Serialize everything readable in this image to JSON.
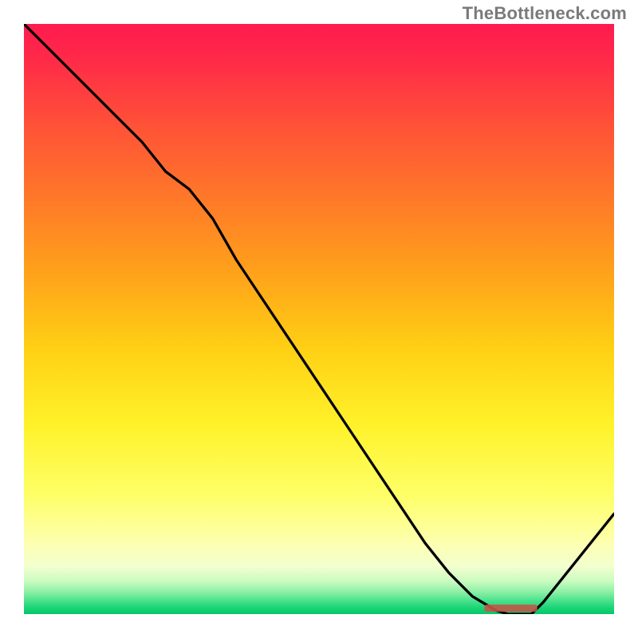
{
  "chart_data": {
    "type": "line",
    "title": "",
    "xlabel": "",
    "ylabel": "",
    "xlim": [
      0,
      100
    ],
    "ylim": [
      0,
      100
    ],
    "x": [
      0,
      4,
      8,
      12,
      16,
      20,
      24,
      28,
      32,
      36,
      40,
      44,
      48,
      52,
      56,
      60,
      64,
      68,
      72,
      76,
      80,
      82,
      84,
      86,
      88,
      92,
      96,
      100
    ],
    "values": [
      100,
      96,
      92,
      88,
      84,
      80,
      75,
      72,
      67,
      60,
      54,
      48,
      42,
      36,
      30,
      24,
      18,
      12,
      7,
      3,
      0.6,
      0,
      0,
      0,
      2,
      7,
      12,
      17
    ],
    "marker_segment": {
      "x_start": 78,
      "x_end": 87,
      "y": 1.0
    },
    "gradient_stops": [
      {
        "offset": 0.0,
        "color": "#ff1a4f"
      },
      {
        "offset": 0.06,
        "color": "#ff2a48"
      },
      {
        "offset": 0.18,
        "color": "#ff5436"
      },
      {
        "offset": 0.3,
        "color": "#ff7a28"
      },
      {
        "offset": 0.42,
        "color": "#ffa11b"
      },
      {
        "offset": 0.55,
        "color": "#ffd014"
      },
      {
        "offset": 0.68,
        "color": "#fff22a"
      },
      {
        "offset": 0.8,
        "color": "#feff68"
      },
      {
        "offset": 0.88,
        "color": "#fdffb0"
      },
      {
        "offset": 0.92,
        "color": "#f2ffcf"
      },
      {
        "offset": 0.945,
        "color": "#c9fbbf"
      },
      {
        "offset": 0.962,
        "color": "#8ef0a6"
      },
      {
        "offset": 0.976,
        "color": "#4fe38e"
      },
      {
        "offset": 0.99,
        "color": "#19d376"
      },
      {
        "offset": 1.0,
        "color": "#04c766"
      }
    ]
  },
  "watermark": "TheBottleneck.com"
}
